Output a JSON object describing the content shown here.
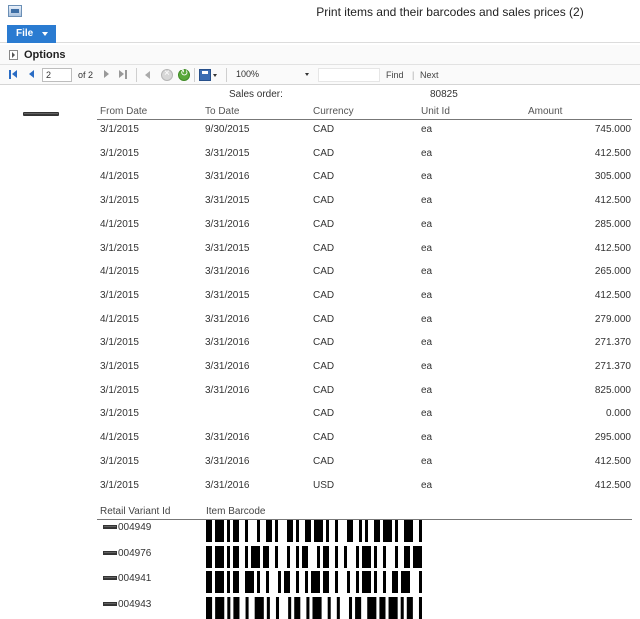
{
  "window": {
    "title": "Print items and their barcodes and sales prices (2)"
  },
  "menu": {
    "file_label": "File"
  },
  "options_bar": {
    "label": "Options"
  },
  "toolbar": {
    "page_value": "2",
    "of_label": "of 2",
    "zoom_value": "100%",
    "find_label": "Find",
    "separator": "|",
    "next_label": "Next"
  },
  "report": {
    "sales_order_label": "Sales order:",
    "sales_order_value": "80825",
    "columns": [
      "From Date",
      "To Date",
      "Currency",
      "Unit Id",
      "Amount"
    ],
    "rows": [
      [
        "3/1/2015",
        "9/30/2015",
        "CAD",
        "ea",
        "745.000"
      ],
      [
        "3/1/2015",
        "3/31/2015",
        "CAD",
        "ea",
        "412.500"
      ],
      [
        "4/1/2015",
        "3/31/2016",
        "CAD",
        "ea",
        "305.000"
      ],
      [
        "3/1/2015",
        "3/31/2015",
        "CAD",
        "ea",
        "412.500"
      ],
      [
        "4/1/2015",
        "3/31/2016",
        "CAD",
        "ea",
        "285.000"
      ],
      [
        "3/1/2015",
        "3/31/2015",
        "CAD",
        "ea",
        "412.500"
      ],
      [
        "4/1/2015",
        "3/31/2016",
        "CAD",
        "ea",
        "265.000"
      ],
      [
        "3/1/2015",
        "3/31/2015",
        "CAD",
        "ea",
        "412.500"
      ],
      [
        "4/1/2015",
        "3/31/2016",
        "CAD",
        "ea",
        "279.000"
      ],
      [
        "3/1/2015",
        "3/31/2016",
        "CAD",
        "ea",
        "271.370"
      ],
      [
        "3/1/2015",
        "3/31/2016",
        "CAD",
        "ea",
        "271.370"
      ],
      [
        "3/1/2015",
        "3/31/2016",
        "CAD",
        "ea",
        "825.000"
      ],
      [
        "3/1/2015",
        "",
        "CAD",
        "ea",
        "0.000"
      ],
      [
        "4/1/2015",
        "3/31/2016",
        "CAD",
        "ea",
        "295.000"
      ],
      [
        "3/1/2015",
        "3/31/2016",
        "CAD",
        "ea",
        "412.500"
      ],
      [
        "3/1/2015",
        "3/31/2016",
        "USD",
        "ea",
        "412.500"
      ]
    ],
    "variant_columns": [
      "Retail Variant Id",
      "Item Barcode"
    ],
    "variants": [
      {
        "id": "004949",
        "barcode_pattern": "2131112213122113211221311213221112213112321"
      },
      {
        "id": "004976",
        "barcode_pattern": "2131112211312213121123112212131131121312213"
      },
      {
        "id": "004941",
        "barcode_pattern": "2131112231121311221211312213121131121221331"
      },
      {
        "id": "004943",
        "barcode_pattern": "2131112212311213112211321213112231213111221"
      }
    ],
    "barcode_color": "#000000"
  }
}
